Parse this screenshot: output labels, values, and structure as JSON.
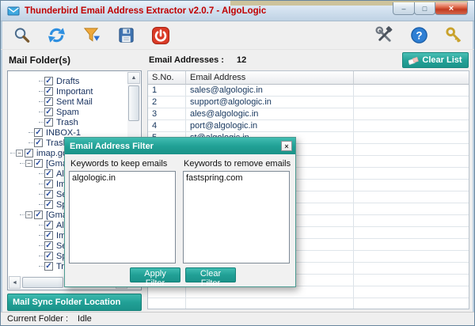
{
  "window": {
    "title": "Thunderbird Email Address Extractor v2.0.7 - AlgoLogic",
    "controls": {
      "minimize": "–",
      "maximize": "□",
      "close": "×"
    }
  },
  "toolbar": {
    "icons": [
      "search-icon",
      "refresh-icon",
      "filter-icon",
      "save-icon",
      "stop-icon",
      "tools-icon",
      "help-icon",
      "key-icon"
    ]
  },
  "panels": {
    "folders_title": "Mail Folder(s)",
    "email_count_label": "Email Addresses :",
    "email_count": "12",
    "clear_list_label": "Clear List"
  },
  "glyphs": {
    "check": "✓",
    "collapse": "−",
    "scroll_up": "▲",
    "scroll_down": "▼",
    "scroll_left": "◄",
    "scroll_right": "►"
  },
  "tree": {
    "items": [
      {
        "label": "Drafts",
        "indent": 38,
        "expander": false
      },
      {
        "label": "Important",
        "indent": 38,
        "expander": false
      },
      {
        "label": "Sent Mail",
        "indent": 38,
        "expander": false
      },
      {
        "label": "Spam",
        "indent": 38,
        "expander": false
      },
      {
        "label": "Trash",
        "indent": 38,
        "expander": false
      },
      {
        "label": "INBOX-1",
        "indent": 25,
        "expander": false
      },
      {
        "label": "Trash-1",
        "indent": 25,
        "expander": false
      },
      {
        "label": "imap.goog...",
        "indent": 2,
        "expander": true
      },
      {
        "label": "[Gmail]...",
        "indent": 14,
        "expander": true
      },
      {
        "label": "All M...",
        "indent": 38,
        "expander": false
      },
      {
        "label": "Imp...",
        "indent": 38,
        "expander": false
      },
      {
        "label": "Sen...",
        "indent": 38,
        "expander": false
      },
      {
        "label": "Spa...",
        "indent": 38,
        "expander": false
      },
      {
        "label": "[Gmail]",
        "indent": 14,
        "expander": true
      },
      {
        "label": "All M...",
        "indent": 38,
        "expander": false
      },
      {
        "label": "Imp...",
        "indent": 38,
        "expander": false
      },
      {
        "label": "Sen...",
        "indent": 38,
        "expander": false
      },
      {
        "label": "Spa...",
        "indent": 38,
        "expander": false
      },
      {
        "label": "Tra...",
        "indent": 38,
        "expander": false
      }
    ]
  },
  "table": {
    "headers": [
      "S.No.",
      "Email Address"
    ],
    "rows": [
      {
        "no": "1",
        "email": "sales@algologic.in"
      },
      {
        "no": "2",
        "email": "support@algologic.in"
      },
      {
        "no": "3",
        "email": "ales@algologic.in"
      },
      {
        "no": "4",
        "email": "port@algologic.in"
      },
      {
        "no": "5",
        "email": "st@algologic.in"
      }
    ]
  },
  "dialog": {
    "title": "Email Address Filter",
    "close": "×",
    "keep_label": "Keywords to keep emails",
    "remove_label": "Keywords to remove emails",
    "keep_value": "algologic.in",
    "remove_value": "fastspring.com",
    "apply_label": "Apply Filter",
    "clear_label": "Clear Filter"
  },
  "footer": {
    "sync_button": "Mail Sync Folder Location",
    "status_label": "Current Folder :",
    "status_value": "Idle"
  },
  "colors": {
    "accent_teal": "#21a096",
    "title_red": "#c00000"
  }
}
